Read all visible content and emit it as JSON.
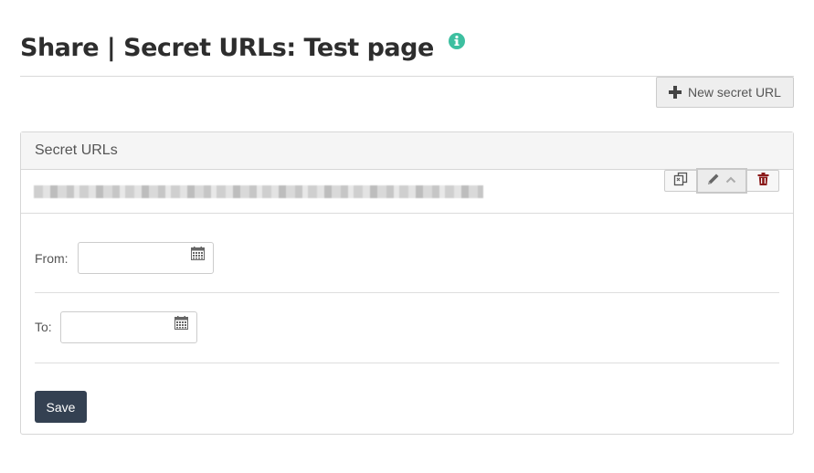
{
  "page": {
    "title": "Share | Secret URLs: Test page",
    "info_icon": "info-circle-icon"
  },
  "toolbar": {
    "new_secret_url_label": "New secret URL",
    "new_secret_url_icon": "plus-icon"
  },
  "panel": {
    "header": "Secret URLs",
    "url_row": {
      "url_text": "",
      "actions": [
        {
          "name": "copy",
          "icon": "copy-icon"
        },
        {
          "name": "edit",
          "icon": "pencil-icon",
          "secondary_icon": "chevron-up-icon"
        },
        {
          "name": "delete",
          "icon": "trash-icon"
        }
      ]
    },
    "form": {
      "from_label": "From:",
      "from_value": "",
      "to_label": "To:",
      "to_value": "",
      "save_label": "Save"
    }
  },
  "colors": {
    "info_icon": "#3dbfa0",
    "save_button": "#344152",
    "delete_icon": "#8b1a1a"
  }
}
